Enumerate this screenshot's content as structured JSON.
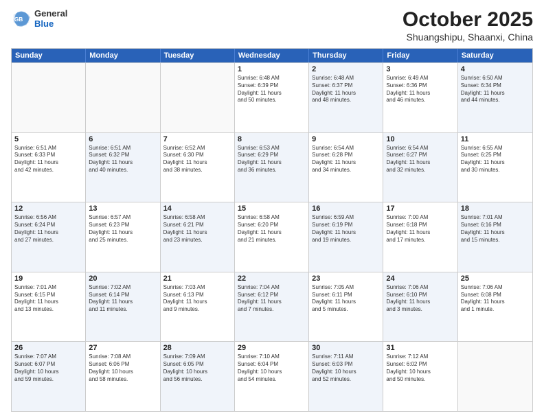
{
  "header": {
    "logo_line1": "General",
    "logo_line2": "Blue",
    "month": "October 2025",
    "location": "Shuangshipu, Shaanxi, China"
  },
  "weekdays": [
    "Sunday",
    "Monday",
    "Tuesday",
    "Wednesday",
    "Thursday",
    "Friday",
    "Saturday"
  ],
  "rows": [
    [
      {
        "day": "",
        "info": ""
      },
      {
        "day": "",
        "info": ""
      },
      {
        "day": "",
        "info": ""
      },
      {
        "day": "1",
        "info": "Sunrise: 6:48 AM\nSunset: 6:39 PM\nDaylight: 11 hours\nand 50 minutes."
      },
      {
        "day": "2",
        "info": "Sunrise: 6:48 AM\nSunset: 6:37 PM\nDaylight: 11 hours\nand 48 minutes."
      },
      {
        "day": "3",
        "info": "Sunrise: 6:49 AM\nSunset: 6:36 PM\nDaylight: 11 hours\nand 46 minutes."
      },
      {
        "day": "4",
        "info": "Sunrise: 6:50 AM\nSunset: 6:34 PM\nDaylight: 11 hours\nand 44 minutes."
      }
    ],
    [
      {
        "day": "5",
        "info": "Sunrise: 6:51 AM\nSunset: 6:33 PM\nDaylight: 11 hours\nand 42 minutes."
      },
      {
        "day": "6",
        "info": "Sunrise: 6:51 AM\nSunset: 6:32 PM\nDaylight: 11 hours\nand 40 minutes."
      },
      {
        "day": "7",
        "info": "Sunrise: 6:52 AM\nSunset: 6:30 PM\nDaylight: 11 hours\nand 38 minutes."
      },
      {
        "day": "8",
        "info": "Sunrise: 6:53 AM\nSunset: 6:29 PM\nDaylight: 11 hours\nand 36 minutes."
      },
      {
        "day": "9",
        "info": "Sunrise: 6:54 AM\nSunset: 6:28 PM\nDaylight: 11 hours\nand 34 minutes."
      },
      {
        "day": "10",
        "info": "Sunrise: 6:54 AM\nSunset: 6:27 PM\nDaylight: 11 hours\nand 32 minutes."
      },
      {
        "day": "11",
        "info": "Sunrise: 6:55 AM\nSunset: 6:25 PM\nDaylight: 11 hours\nand 30 minutes."
      }
    ],
    [
      {
        "day": "12",
        "info": "Sunrise: 6:56 AM\nSunset: 6:24 PM\nDaylight: 11 hours\nand 27 minutes."
      },
      {
        "day": "13",
        "info": "Sunrise: 6:57 AM\nSunset: 6:23 PM\nDaylight: 11 hours\nand 25 minutes."
      },
      {
        "day": "14",
        "info": "Sunrise: 6:58 AM\nSunset: 6:21 PM\nDaylight: 11 hours\nand 23 minutes."
      },
      {
        "day": "15",
        "info": "Sunrise: 6:58 AM\nSunset: 6:20 PM\nDaylight: 11 hours\nand 21 minutes."
      },
      {
        "day": "16",
        "info": "Sunrise: 6:59 AM\nSunset: 6:19 PM\nDaylight: 11 hours\nand 19 minutes."
      },
      {
        "day": "17",
        "info": "Sunrise: 7:00 AM\nSunset: 6:18 PM\nDaylight: 11 hours\nand 17 minutes."
      },
      {
        "day": "18",
        "info": "Sunrise: 7:01 AM\nSunset: 6:16 PM\nDaylight: 11 hours\nand 15 minutes."
      }
    ],
    [
      {
        "day": "19",
        "info": "Sunrise: 7:01 AM\nSunset: 6:15 PM\nDaylight: 11 hours\nand 13 minutes."
      },
      {
        "day": "20",
        "info": "Sunrise: 7:02 AM\nSunset: 6:14 PM\nDaylight: 11 hours\nand 11 minutes."
      },
      {
        "day": "21",
        "info": "Sunrise: 7:03 AM\nSunset: 6:13 PM\nDaylight: 11 hours\nand 9 minutes."
      },
      {
        "day": "22",
        "info": "Sunrise: 7:04 AM\nSunset: 6:12 PM\nDaylight: 11 hours\nand 7 minutes."
      },
      {
        "day": "23",
        "info": "Sunrise: 7:05 AM\nSunset: 6:11 PM\nDaylight: 11 hours\nand 5 minutes."
      },
      {
        "day": "24",
        "info": "Sunrise: 7:06 AM\nSunset: 6:10 PM\nDaylight: 11 hours\nand 3 minutes."
      },
      {
        "day": "25",
        "info": "Sunrise: 7:06 AM\nSunset: 6:08 PM\nDaylight: 11 hours\nand 1 minute."
      }
    ],
    [
      {
        "day": "26",
        "info": "Sunrise: 7:07 AM\nSunset: 6:07 PM\nDaylight: 10 hours\nand 59 minutes."
      },
      {
        "day": "27",
        "info": "Sunrise: 7:08 AM\nSunset: 6:06 PM\nDaylight: 10 hours\nand 58 minutes."
      },
      {
        "day": "28",
        "info": "Sunrise: 7:09 AM\nSunset: 6:05 PM\nDaylight: 10 hours\nand 56 minutes."
      },
      {
        "day": "29",
        "info": "Sunrise: 7:10 AM\nSunset: 6:04 PM\nDaylight: 10 hours\nand 54 minutes."
      },
      {
        "day": "30",
        "info": "Sunrise: 7:11 AM\nSunset: 6:03 PM\nDaylight: 10 hours\nand 52 minutes."
      },
      {
        "day": "31",
        "info": "Sunrise: 7:12 AM\nSunset: 6:02 PM\nDaylight: 10 hours\nand 50 minutes."
      },
      {
        "day": "",
        "info": ""
      }
    ]
  ]
}
